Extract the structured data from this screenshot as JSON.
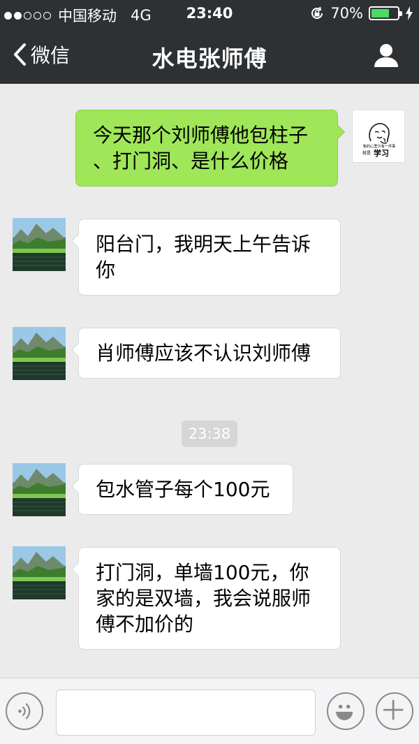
{
  "status_bar": {
    "carrier": "中国移动",
    "network": "4G",
    "time": "23:40",
    "battery": "70%",
    "battery_level": 0.7,
    "signal_filled": 2,
    "signal_total": 5
  },
  "nav": {
    "back_label": "微信",
    "title": "水电张师傅"
  },
  "messages": [
    {
      "from": "me",
      "text_lines": [
        "今天那个刘师傅他包柱子",
        "、打门洞、是什么价格"
      ]
    },
    {
      "from": "contact",
      "text_lines": [
        "阳台门，我明天上午告诉",
        "你"
      ]
    },
    {
      "from": "contact",
      "text_lines": [
        "肖师傅应该不认识刘师傅"
      ]
    },
    {
      "from": "contact",
      "text_lines": [
        "包水管子每个100元"
      ]
    },
    {
      "from": "contact",
      "text_lines": [
        "打门洞，单墙100元，你",
        "家的是双墙，我会说服师",
        "傅不加价的"
      ]
    }
  ],
  "time_divider": "23:38",
  "user_avatar": {
    "caption_small": "我的心里只有一件事",
    "caption_prefix": "就是",
    "caption_big": "学习"
  },
  "input_bar": {
    "voice_icon": "voice-icon",
    "emoji_icon": "emoji-icon",
    "plus_icon": "plus-icon",
    "placeholder": ""
  },
  "colors": {
    "header_bg": "#2e3133",
    "chat_bg": "#ebebeb",
    "outgoing_bubble": "#9fe658",
    "incoming_bubble": "#ffffff",
    "battery_green": "#4cd964"
  }
}
